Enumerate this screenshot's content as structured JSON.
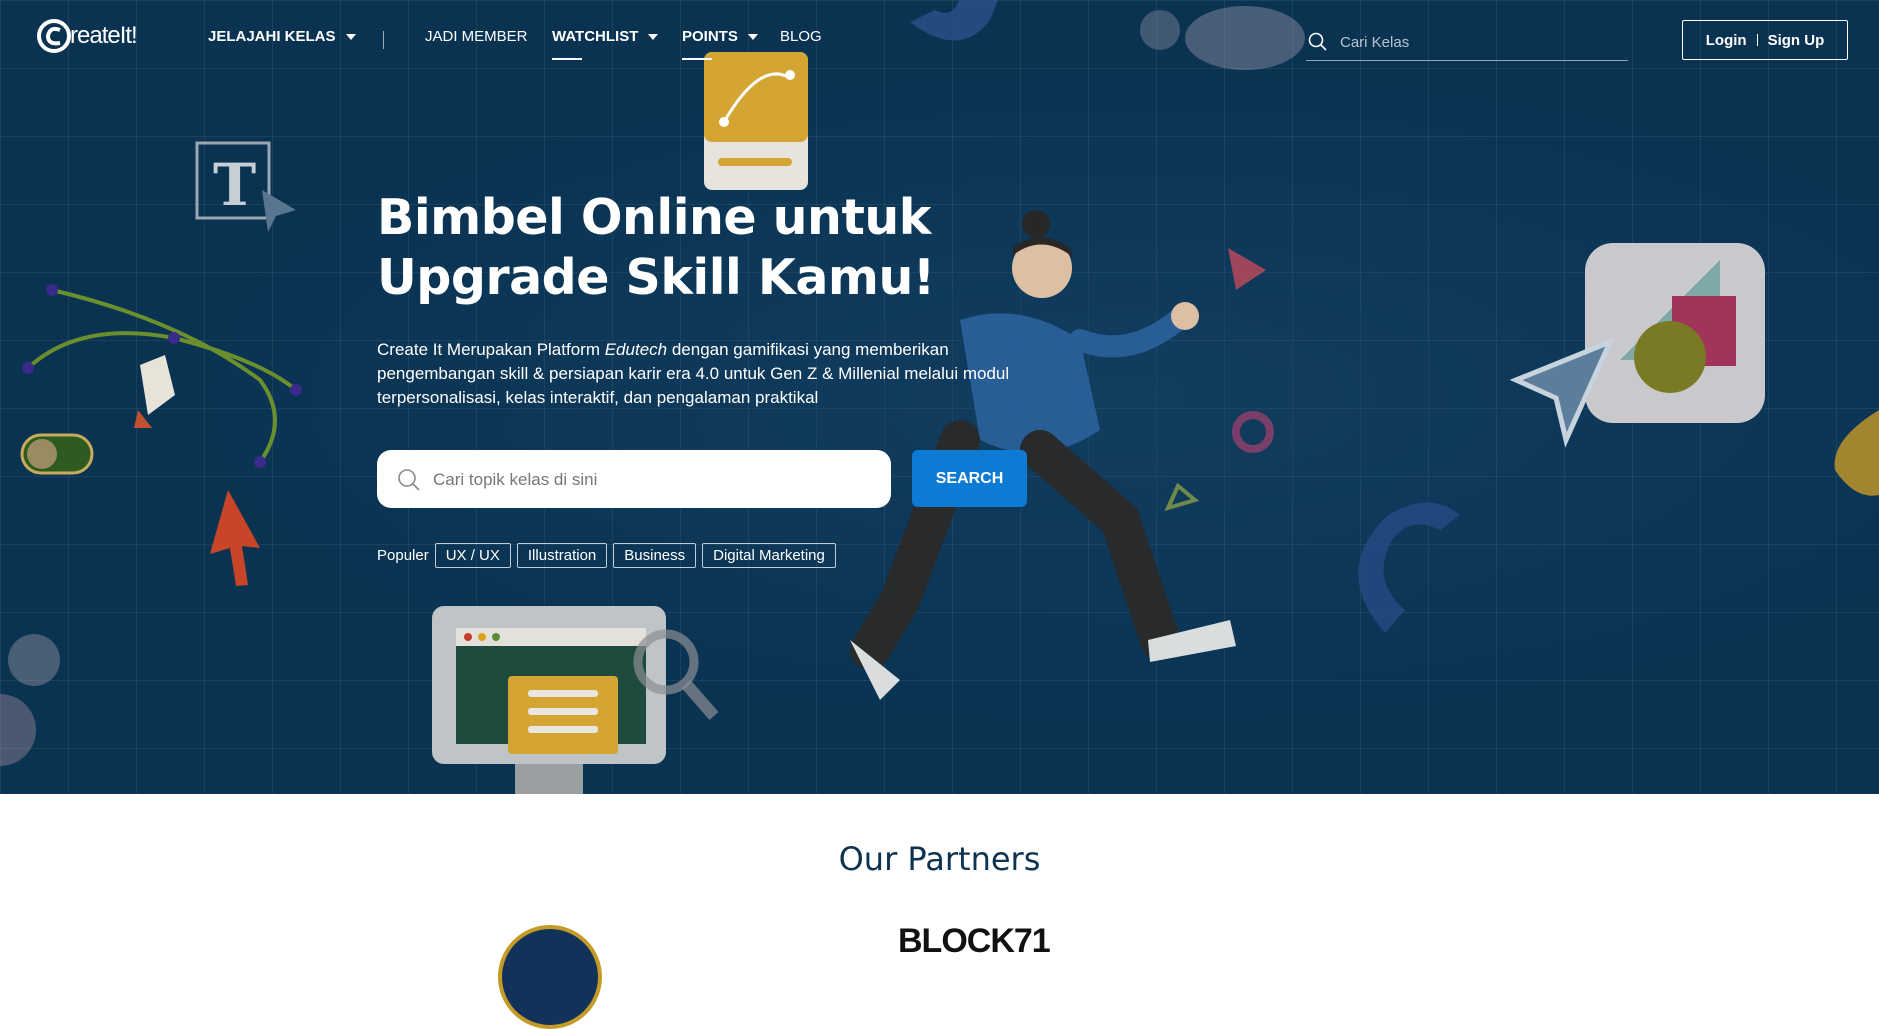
{
  "brand": {
    "logo_text": "reateIt!"
  },
  "nav": {
    "items": [
      {
        "label": "JELAJAHI KELAS"
      },
      {
        "label": "JADI MEMBER"
      },
      {
        "label": "WATCHLIST"
      },
      {
        "label": "POINTS"
      },
      {
        "label": "BLOG"
      }
    ],
    "search_placeholder": "Cari Kelas",
    "login": "Login",
    "signup": "Sign Up"
  },
  "hero": {
    "headline_line1": "Bimbel Online untuk",
    "headline_line2": "Upgrade Skill Kamu!",
    "sub_part1": "Create It Merupakan Platform ",
    "sub_em": "Edutech",
    "sub_part2": " dengan gamifikasi yang memberikan pengembangan skill & persiapan karir era 4.0 untuk Gen Z & Millenial melalui modul terpersonalisasi, kelas interaktif, dan pengalaman praktikal",
    "search_placeholder": "Cari topik kelas di sini",
    "search_button": "SEARCH",
    "populer_label": "Populer",
    "tags": [
      "UX / UX",
      "Illustration",
      "Business",
      "Digital Marketing"
    ]
  },
  "partners": {
    "title": "Our Partners",
    "logo2_text": "BLOCK71"
  },
  "colors": {
    "hero_bg": "#0a3352",
    "primary_button": "#0d7bd3",
    "partners_title": "#0d3350"
  }
}
